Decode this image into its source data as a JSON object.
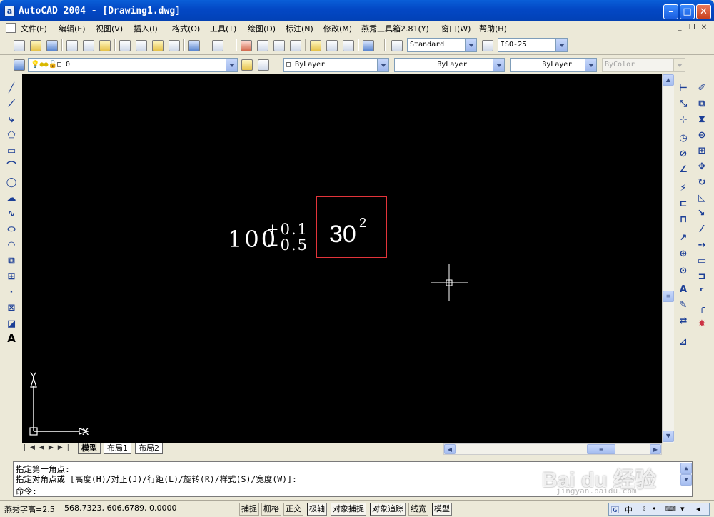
{
  "window": {
    "title": "AutoCAD 2004 - [Drawing1.dwg]",
    "app_icon": "a"
  },
  "menu": [
    "文件(F)",
    "编辑(E)",
    "视图(V)",
    "插入(I)",
    "格式(O)",
    "工具(T)",
    "绘图(D)",
    "标注(N)",
    "修改(M)",
    "燕秀工具箱2.81(Y)",
    "窗口(W)",
    "帮助(H)"
  ],
  "toolbar": {
    "text_style": "Standard",
    "dim_style": "ISO-25",
    "layer": "0",
    "color": "ByLayer",
    "linetype": "ByLayer",
    "lineweight": "ByLayer",
    "plot_style": "ByColor"
  },
  "drawing": {
    "dimension_main": "100",
    "tolerance_upper": "+0.1",
    "tolerance_lower": "−0.5",
    "power_base": "30",
    "power_exponent": "2",
    "ucs_y": "Y",
    "ucs_x": "X"
  },
  "tabs": [
    "模型",
    "布局1",
    "布局2"
  ],
  "command": {
    "line1": "指定第一角点:",
    "line2": "指定对角点或 [高度(H)/对正(J)/行距(L)/旋转(R)/样式(S)/宽度(W)]:",
    "prompt": "命令:"
  },
  "status": {
    "text_height": "燕秀字高=2.5",
    "coords": "568.7323,  606.6789,  0.0000",
    "buttons": [
      "捕捉",
      "栅格",
      "正交",
      "极轴",
      "对象捕捉",
      "对象追踪",
      "线宽",
      "模型"
    ]
  },
  "watermark": {
    "brand": "Bai du 经验",
    "url": "jingyan.baidu.com"
  },
  "tray": {
    "ime": "中"
  },
  "colors": {
    "titlebar": "#0348c5",
    "canvas": "#000000",
    "highlight": "#e3343a"
  }
}
